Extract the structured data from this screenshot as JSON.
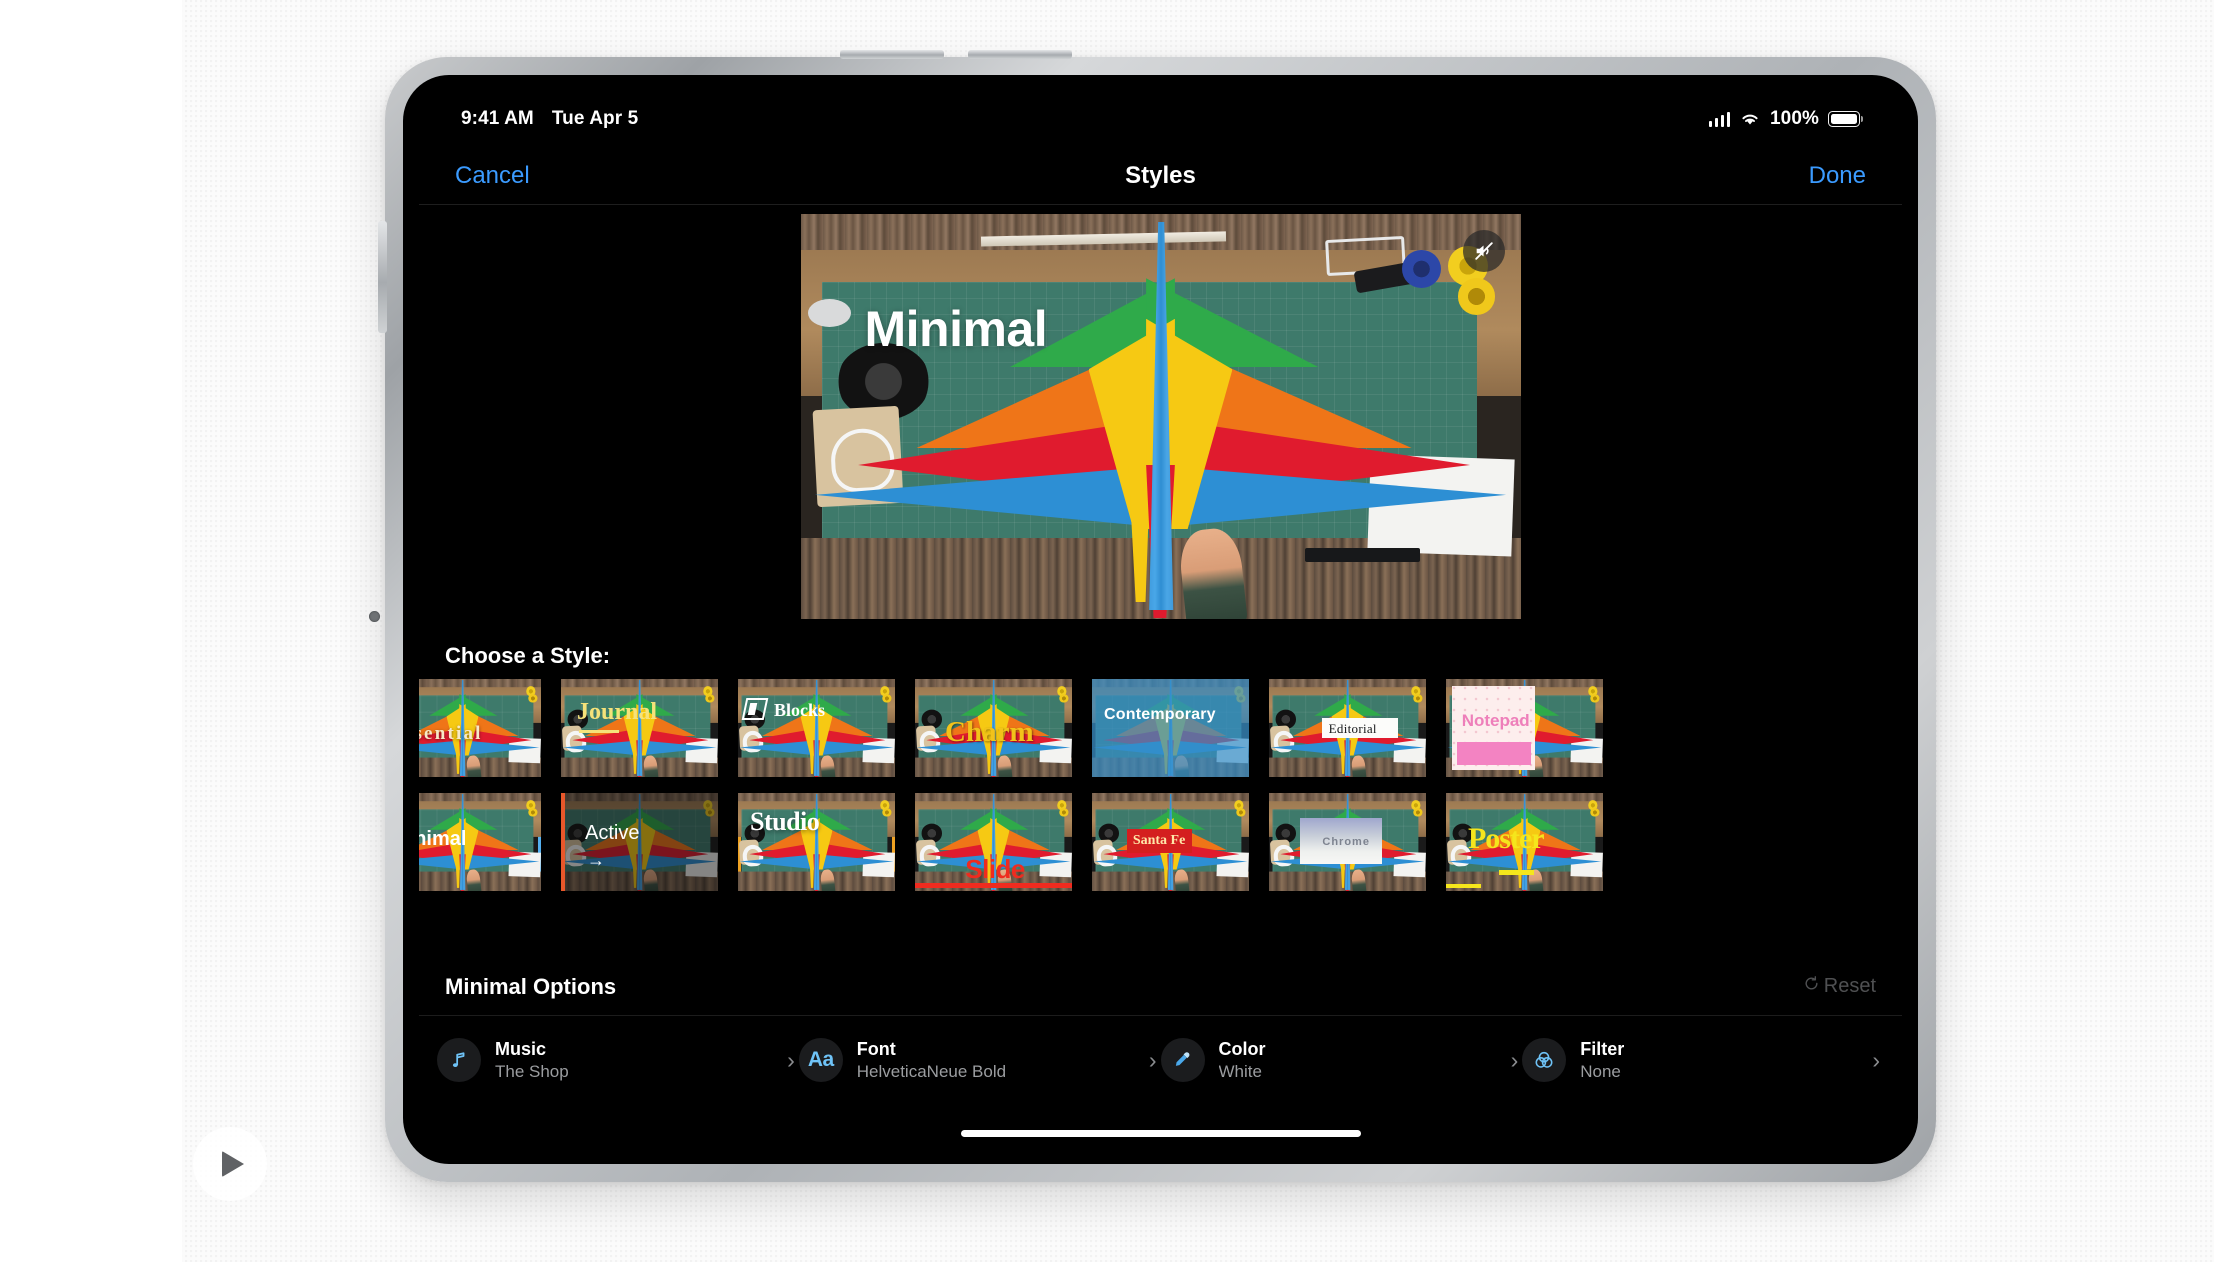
{
  "status_bar": {
    "time": "9:41 AM",
    "date": "Tue Apr 5",
    "battery_percent": "100%",
    "icons": [
      "cellular-signal-icon",
      "wifi-icon",
      "battery-icon"
    ]
  },
  "nav_bar": {
    "cancel_label": "Cancel",
    "title": "Styles",
    "done_label": "Done",
    "accent_color": "#3b9bff"
  },
  "preview": {
    "style_title": "Minimal",
    "mute_icon": "speaker-mute-icon",
    "muted": true
  },
  "chooser": {
    "label": "Choose a Style:",
    "rows": [
      [
        {
          "name": "Essential",
          "selected": false,
          "clipped": true
        },
        {
          "name": "Journal",
          "selected": false
        },
        {
          "name": "Blocks",
          "selected": false
        },
        {
          "name": "Charm",
          "selected": false
        },
        {
          "name": "Contemporary",
          "selected": false
        },
        {
          "name": "Editorial",
          "selected": false
        },
        {
          "name": "Notepad",
          "selected": false
        }
      ],
      [
        {
          "name": "Minimal",
          "selected": true,
          "clipped": true
        },
        {
          "name": "Active",
          "selected": false
        },
        {
          "name": "Studio",
          "selected": true
        },
        {
          "name": "Slide",
          "selected": false
        },
        {
          "name": "Santa Fe",
          "selected": false
        },
        {
          "name": "Chrome",
          "selected": false
        },
        {
          "name": "Poster",
          "selected": false
        }
      ]
    ],
    "selected_outline_blue": "#54b0ef",
    "selected_outline_amber": "#efa222"
  },
  "options": {
    "title": "Minimal Options",
    "reset_label": "Reset",
    "reset_icon": "refresh-counterclockwise-icon",
    "items": [
      {
        "icon": "music-note-icon",
        "name": "Music",
        "value": "The Shop",
        "chevron": "›"
      },
      {
        "icon": "font-aa-icon",
        "name": "Font",
        "value": "HelveticaNeue Bold",
        "chevron": "›",
        "glyph": "Aa"
      },
      {
        "icon": "eyedropper-icon",
        "name": "Color",
        "value": "White",
        "chevron": "›"
      },
      {
        "icon": "filter-circles-icon",
        "name": "Filter",
        "value": "None",
        "chevron": "›"
      }
    ]
  },
  "overlay": {
    "play_icon": "play-icon"
  }
}
